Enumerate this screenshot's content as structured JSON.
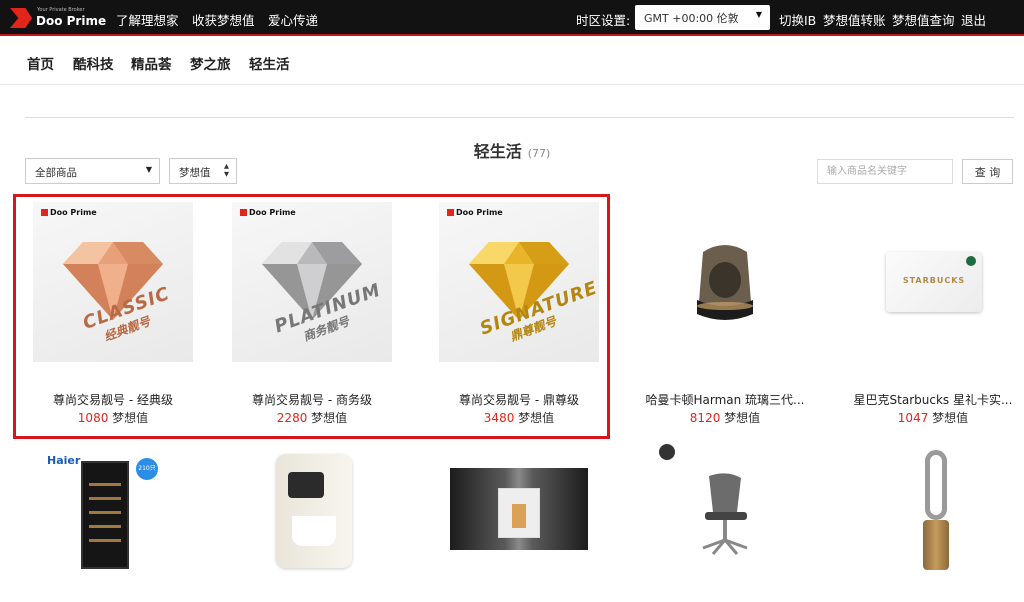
{
  "brand": {
    "tagline": "Your Private Broker",
    "name": "Doo Prime"
  },
  "topnav": {
    "links": [
      "了解理想家",
      "收获梦想值",
      "爱心传递"
    ],
    "timezone_label": "时区设置:",
    "timezone_value": "GMT +00:00 伦敦",
    "right_links": [
      "切换IB",
      "梦想值转账",
      "梦想值查询",
      "退出"
    ]
  },
  "catnav": [
    "首页",
    "酷科技",
    "精品荟",
    "梦之旅",
    "轻生活"
  ],
  "page": {
    "title": "轻生活",
    "count": "(77)"
  },
  "filters": {
    "category": "全部商品",
    "sort": "梦想值",
    "search_placeholder": "输入商品名关键字",
    "search_button": "查 询"
  },
  "price_unit": "梦想值",
  "products": [
    {
      "name": "尊尚交易靓号 - 经典级",
      "price": "1080",
      "img_label": "Doo Prime",
      "tier": "CLASSIC",
      "tier_cn": "经典靓号"
    },
    {
      "name": "尊尚交易靓号 - 商务级",
      "price": "2280",
      "img_label": "Doo Prime",
      "tier": "PLATINUM",
      "tier_cn": "商务靓号"
    },
    {
      "name": "尊尚交易靓号 - 鼎尊级",
      "price": "3480",
      "img_label": "Doo Prime",
      "tier": "SIGNATURE",
      "tier_cn": "鼎尊靓号"
    },
    {
      "name": "哈曼卡顿Harman 琉璃三代...",
      "price": "8120"
    },
    {
      "name": "星巴克Starbucks 星礼卡实...",
      "price": "1047",
      "img_label": "STARBUCKS"
    }
  ],
  "row2": {
    "haier_label": "Haier",
    "badge": "210只"
  },
  "colors": {
    "accent": "#e1251b",
    "topbar": "#121212",
    "highlight": "#d7151b"
  }
}
